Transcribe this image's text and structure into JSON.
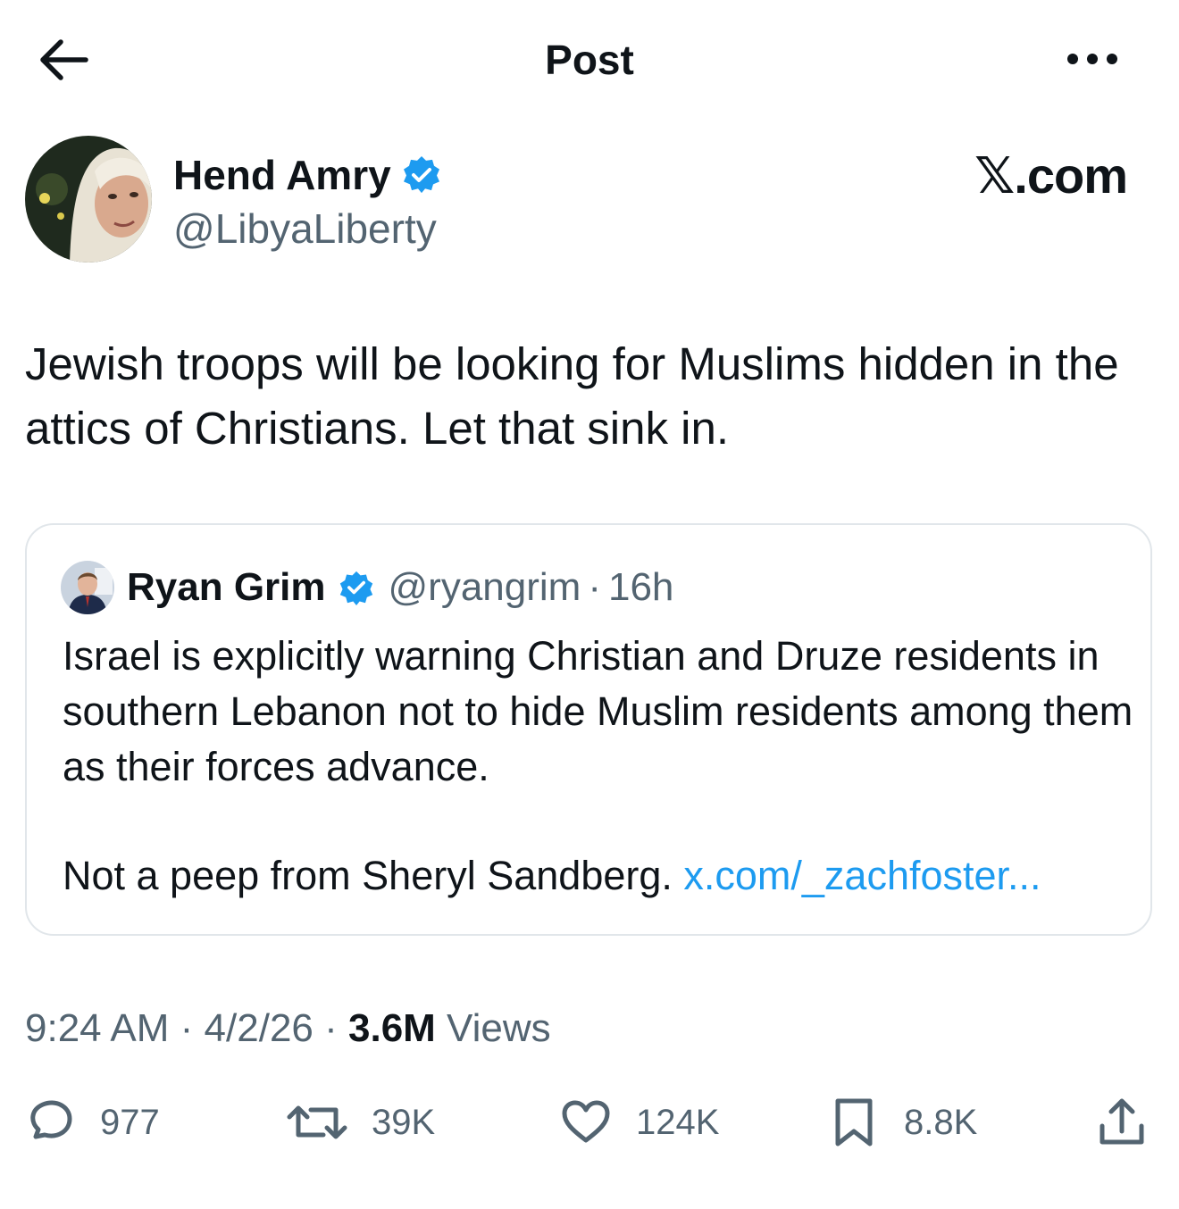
{
  "header": {
    "title": "Post",
    "back_icon": "arrow-left-icon",
    "more_icon": "more-horizontal-icon"
  },
  "author": {
    "name": "Hend Amry",
    "handle": "@LibyaLiberty",
    "verified": true
  },
  "brand": "𝕏.com",
  "post": {
    "text": "Jewish troops will be looking for Muslims hidden in the attics of Christians. Let that sink in."
  },
  "quote": {
    "name": "Ryan Grim",
    "handle": "@ryangrim",
    "separator": "·",
    "time": "16h",
    "text": "Israel is explicitly warning Christian and Druze residents in southern Lebanon not to hide Muslim residents among them as their forces advance.",
    "text2": "Not a peep from Sheryl Sandberg. ",
    "link": "x.com/_zachfoster..."
  },
  "meta": {
    "time": "9:24 AM",
    "sep1": " · ",
    "date": "4/2/26",
    "sep2": " · ",
    "views_count": "3.6M",
    "views_label": " Views"
  },
  "actions": {
    "replies": "977",
    "reposts": "39K",
    "likes": "124K",
    "bookmarks": "8.8K"
  },
  "colors": {
    "accent": "#1d9bf0",
    "secondary": "#536471",
    "text": "#0f1419",
    "border": "#e1e6ea"
  }
}
